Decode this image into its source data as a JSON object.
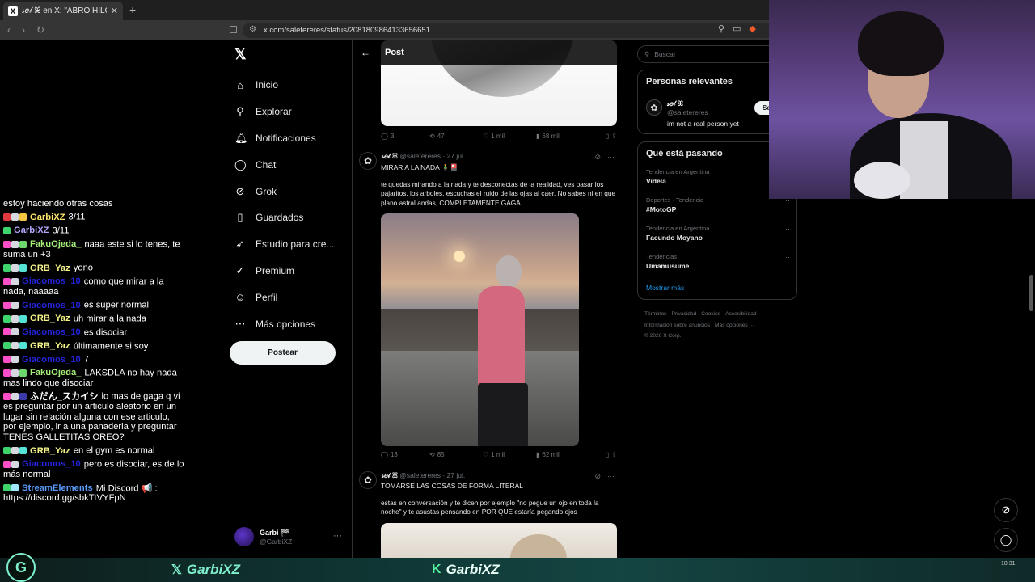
{
  "browser": {
    "tab_title": "𝓈𝑒𝓁 ꕤ en X: \"ABRO HILO DE TO",
    "tab_favicon": "X",
    "url": "x.com/saletereres/status/2081809864133656651"
  },
  "chat": [
    {
      "user": "",
      "color": "#ffffff",
      "badges": [],
      "text": "estoy haciendo otras cosas"
    },
    {
      "user": "GarbiXZ",
      "color": "#ffe76a",
      "badges": [
        "#e0393f",
        "#d7d7e0",
        "#f4c542"
      ],
      "text": "3/11"
    },
    {
      "user": "GarbiXZ",
      "color": "#b6a4ff",
      "badges": [
        "#3fd46b"
      ],
      "text": "3/11"
    },
    {
      "user": "FakuOjeda_",
      "color": "#a6f07a",
      "badges": [
        "#ff4fc8",
        "#d7d7e0",
        "#6dd66d"
      ],
      "text": "naaa este si lo tenes, te suma un +3"
    },
    {
      "user": "GRB_Yaz",
      "color": "#f5f58a",
      "badges": [
        "#3fd46b",
        "#d7d7e0",
        "#54e3d4"
      ],
      "text": "yono"
    },
    {
      "user": "Giacomos_10",
      "color": "#2323d8",
      "badges": [
        "#ff4fc8",
        "#d7d7e0"
      ],
      "text": "como que mirar a la nada, naaaaa"
    },
    {
      "user": "Giacomos_10",
      "color": "#2323d8",
      "badges": [
        "#ff4fc8",
        "#d7d7e0"
      ],
      "text": "es super normal"
    },
    {
      "user": "GRB_Yaz",
      "color": "#f5f58a",
      "badges": [
        "#3fd46b",
        "#d7d7e0",
        "#54e3d4"
      ],
      "text": "uh mirar a la nada"
    },
    {
      "user": "Giacomos_10",
      "color": "#2323d8",
      "badges": [
        "#ff4fc8",
        "#d7d7e0"
      ],
      "text": "es disociar"
    },
    {
      "user": "GRB_Yaz",
      "color": "#f5f58a",
      "badges": [
        "#3fd46b",
        "#d7d7e0",
        "#54e3d4"
      ],
      "text": "últimamente si soy"
    },
    {
      "user": "Giacomos_10",
      "color": "#2323d8",
      "badges": [
        "#ff4fc8",
        "#d7d7e0"
      ],
      "text": "7"
    },
    {
      "user": "FakuOjeda_",
      "color": "#a6f07a",
      "badges": [
        "#ff4fc8",
        "#d7d7e0",
        "#6dd66d"
      ],
      "text": "LAKSDLA no hay nada mas lindo que disociar"
    },
    {
      "user": "ふだん_スカイシ",
      "color": "#ffffff",
      "badges": [
        "#ff4fc8",
        "#d7d7e0",
        "#3a3aaa"
      ],
      "text": "lo mas de gaga q vi es preguntar por un articulo aleatorio en un lugar sin relación alguna con ese articulo, por ejemplo, ir a una panaderia y preguntar TENES GALLETITAS OREO?"
    },
    {
      "user": "GRB_Yaz",
      "color": "#f5f58a",
      "badges": [
        "#3fd46b",
        "#d7d7e0",
        "#54e3d4"
      ],
      "text": "en el gym es normal"
    },
    {
      "user": "Giacomos_10",
      "color": "#2323d8",
      "badges": [
        "#ff4fc8",
        "#d7d7e0"
      ],
      "text": "pero es disociar, es de lo más normal"
    },
    {
      "user": "StreamElements",
      "color": "#5b9cff",
      "badges": [
        "#3fd46b",
        "#9fe8ff"
      ],
      "text": "Mi Discord 📢 : https://discord.gg/sbkTtVYFpN"
    }
  ],
  "sidebar": {
    "logo": "𝕏",
    "items": [
      {
        "label": "Inicio",
        "icon": "⌂"
      },
      {
        "label": "Explorar",
        "icon": "⚲"
      },
      {
        "label": "Notificaciones",
        "icon": "🔔︎"
      },
      {
        "label": "Chat",
        "icon": "◯"
      },
      {
        "label": "Grok",
        "icon": "⊘"
      },
      {
        "label": "Guardados",
        "icon": "▯"
      },
      {
        "label": "Estudio para cre...",
        "icon": "➶"
      },
      {
        "label": "Premium",
        "icon": "✓"
      },
      {
        "label": "Perfil",
        "icon": "☺"
      },
      {
        "label": "Más opciones",
        "icon": "⋯"
      }
    ],
    "post_button": "Postear",
    "profile_name": "Garbi 🏁",
    "profile_handle": "@GarbiXZ",
    "profile_more": "···"
  },
  "timeline": {
    "header_title": "Post",
    "tweets": [
      {
        "actions": {
          "replies": "3",
          "retweets": "47",
          "likes": "1 mil",
          "views": "68 mil"
        }
      },
      {
        "avatar": "✿",
        "name": "𝓈𝑒𝓁 ꕤ",
        "handle": "@saletereres",
        "date": "27 jul.",
        "title": "MIRAR A LA NADA 🧍‍♂️🎴",
        "body": "te quedas mirando a la nada y te desconectas de la realidad, ves pasar los pajaritos, los arboles, escuchas el ruido de las ojas al caer. No sabes ni en que plano astral andas, COMPLETAMENTE GAGA",
        "actions": {
          "replies": "13",
          "retweets": "85",
          "likes": "1 mil",
          "views": "62 mil"
        }
      },
      {
        "avatar": "✿",
        "name": "𝓈𝑒𝓁 ꕤ",
        "handle": "@saletereres",
        "date": "27 jul.",
        "title": "TOMARSE LAS COSAS DE FORMA LITERAL",
        "body": "estas en conversación y te dicen por ejemplo \"no pegue un ojo en toda la noche\" y te asustas pensando en POR QUE estaría pegando ojos"
      }
    ]
  },
  "right": {
    "search_placeholder": "Buscar",
    "relevant_title": "Personas relevantes",
    "relevant_name": "𝓈𝑒𝓁 ꕤ",
    "relevant_handle": "@saletereres",
    "relevant_bio": "im not a real person yet",
    "follow_label": "Se",
    "trends_title": "Qué está pasando",
    "trends": [
      {
        "meta": "Tendencia en Argentina",
        "name": "Videla"
      },
      {
        "meta": "Deportes · Tendencia",
        "name": "#MotoGP"
      },
      {
        "meta": "Tendencia en Argentina",
        "name": "Facundo Moyano"
      },
      {
        "meta": "Tendencias",
        "name": "Umamusume"
      }
    ],
    "show_more": "Mostrar más",
    "footer_line1": [
      "Términos",
      "Privacidad",
      "Cookies",
      "Accesibilidad"
    ],
    "footer_line2": [
      "Información sobre anuncios",
      "Más opciones ···"
    ],
    "footer_line3": "© 2026 X Corp."
  },
  "stream_bar": {
    "twitter_handle": "GarbiXZ",
    "kick_handle": "GarbiXZ",
    "clock": "10:31"
  }
}
